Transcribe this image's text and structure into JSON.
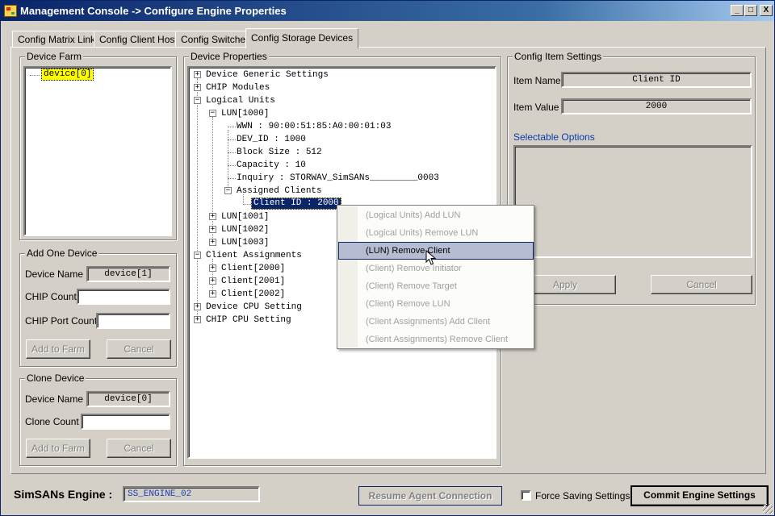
{
  "window": {
    "title": "Management Console -> Configure Engine Properties",
    "controls": {
      "minimize": "_",
      "maximize": "□",
      "close": "X"
    }
  },
  "tabs": [
    {
      "label": "Config Matrix Links"
    },
    {
      "label": "Config Client Hosts"
    },
    {
      "label": "Config Switches"
    },
    {
      "label": "Config Storage Devices"
    }
  ],
  "device_farm": {
    "title": "Device Farm",
    "items": [
      "device[0]"
    ]
  },
  "add_one_device": {
    "title": "Add One Device",
    "device_name_label": "Device Name",
    "device_name_value": "device[1]",
    "chip_count_label": "CHIP Count",
    "chip_count_value": "",
    "chip_port_count_label": "CHIP Port Count",
    "chip_port_count_value": "",
    "add_button": "Add to Farm",
    "cancel_button": "Cancel"
  },
  "clone_device": {
    "title": "Clone Device",
    "device_name_label": "Device Name",
    "device_name_value": "device[0]",
    "clone_count_label": "Clone Count",
    "clone_count_value": "",
    "add_button": "Add to Farm",
    "cancel_button": "Cancel"
  },
  "device_properties": {
    "title": "Device Properties",
    "tree": [
      "Device Generic Settings",
      "CHIP Modules",
      "Logical Units",
      "LUN[1000]",
      "WWN : 90:00:51:85:A0:00:01:03",
      "DEV_ID : 1000",
      "Block Size : 512",
      "Capacity : 10",
      "Inquiry : STORWAV_SimSANs_________0003",
      "Assigned Clients",
      "Client ID : 2000",
      "LUN[1001]",
      "LUN[1002]",
      "LUN[1003]",
      "Client Assignments",
      "Client[2000]",
      "Client[2001]",
      "Client[2002]",
      "Device CPU Setting",
      "CHIP CPU Setting"
    ]
  },
  "config_item": {
    "title": "Config Item Settings",
    "item_name_label": "Item Name",
    "item_name_value": "Client ID",
    "item_value_label": "Item Value",
    "item_value_value": "2000",
    "selectable_options_label": "Selectable Options",
    "apply_button": "Apply",
    "cancel_button": "Cancel"
  },
  "context_menu": {
    "items": [
      "(Logical Units) Add LUN",
      "(Logical Units) Remove LUN",
      "(LUN) Remove Client",
      "(Client) Remove Initiator",
      "(Client) Remove Target",
      "(Client) Remove LUN",
      "(Client Assignments) Add Client",
      "(Client Assignments) Remove Client"
    ]
  },
  "footer": {
    "engine_label": "SimSANs Engine :",
    "engine_value": "SS_ENGINE_02",
    "resume_button": "Resume Agent Connection",
    "force_saving_label": "Force Saving Settings",
    "commit_button": "Commit Engine Settings"
  }
}
